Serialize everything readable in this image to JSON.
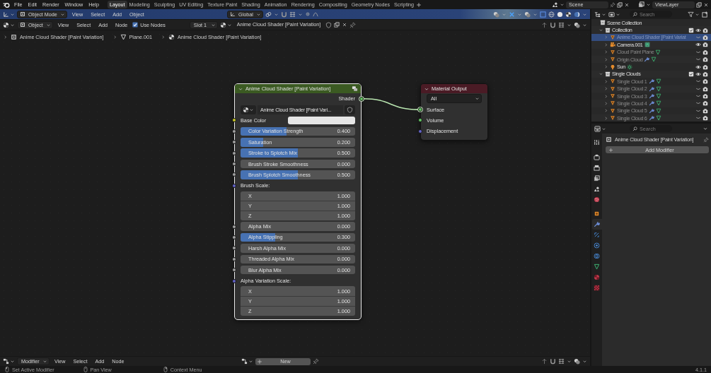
{
  "menu": [
    "File",
    "Edit",
    "Render",
    "Window",
    "Help"
  ],
  "workspaces": [
    {
      "label": "Layout",
      "selected": true
    },
    {
      "label": "Modeling",
      "selected": false
    },
    {
      "label": "Sculpting",
      "selected": false
    },
    {
      "label": "UV Editing",
      "selected": false
    },
    {
      "label": "Texture Paint",
      "selected": false
    },
    {
      "label": "Shading",
      "selected": false
    },
    {
      "label": "Animation",
      "selected": false
    },
    {
      "label": "Rendering",
      "selected": false
    },
    {
      "label": "Compositing",
      "selected": false
    },
    {
      "label": "Geometry Nodes",
      "selected": false
    },
    {
      "label": "Scripting",
      "selected": false
    }
  ],
  "scene": "Scene",
  "view_layer": "ViewLayer",
  "viewport_header": {
    "mode": "Object Mode",
    "menus": [
      "View",
      "Select",
      "Add",
      "Object"
    ],
    "orientation": "Global"
  },
  "node_editor": {
    "header": {
      "type": "Object",
      "menus": [
        "View",
        "Select",
        "Add",
        "Node"
      ],
      "use_nodes": {
        "label": "Use Nodes",
        "checked": true
      },
      "slot": "Slot 1",
      "material": "Anime Cloud Shader [Paint Variation]"
    },
    "breadcrumbs": [
      "Anime Cloud Shader [Paint Variation]",
      "Plane.001",
      "Anime Cloud Shader [Paint Variation]"
    ],
    "nodes": [
      {
        "kind": "group",
        "title": "Anime Cloud Shader [Paint Variation]",
        "selected": true,
        "outputs": [
          {
            "label": "Shader",
            "kind": "shader",
            "linked": true
          }
        ],
        "group": "Anime Cloud Shader [Paint Vari...",
        "inputs": [
          {
            "kind": "color",
            "label": "Base Color",
            "color": "#e6e6e6"
          },
          {
            "kind": "slider",
            "label": "Color Variation Strength",
            "value": "0.400",
            "level": 0.4
          },
          {
            "kind": "slider",
            "label": "Saturation",
            "value": "0.200",
            "level": 0.2
          },
          {
            "kind": "slider",
            "label": "Stroke to Splotch Mix",
            "value": "0.500",
            "level": 0.5
          },
          {
            "kind": "slider",
            "label": "Brush Stroke Smoothness",
            "value": "0.000",
            "level": 0
          },
          {
            "kind": "slider",
            "label": "Brush Splotch Smoothness",
            "value": "0.500",
            "level": 0.5
          },
          {
            "kind": "vector",
            "label": "Brush Scale:",
            "components": [
              {
                "label": "X",
                "value": "1.000"
              },
              {
                "label": "Y",
                "value": "1.000"
              },
              {
                "label": "Z",
                "value": "1.000"
              }
            ]
          },
          {
            "kind": "slider",
            "label": "Alpha Mix",
            "value": "0.000",
            "level": 0
          },
          {
            "kind": "slider",
            "label": "Alpha Stippling",
            "value": "0.300",
            "level": 0.3
          },
          {
            "kind": "slider",
            "label": "Harsh Alpha Mix",
            "value": "0.000",
            "level": 0
          },
          {
            "kind": "slider",
            "label": "Threaded Alpha Mix",
            "value": "0.000",
            "level": 0
          },
          {
            "kind": "slider",
            "label": "Blur Alpha Mix",
            "value": "0.000",
            "level": 0
          },
          {
            "kind": "vector",
            "label": "Alpha Variation Scale:",
            "components": [
              {
                "label": "X",
                "value": "1.000"
              },
              {
                "label": "Y",
                "value": "1.000"
              },
              {
                "label": "Z",
                "value": "1.000"
              }
            ]
          }
        ]
      },
      {
        "kind": "output",
        "title": "Material Output",
        "selected": false,
        "target": "All",
        "inputs": [
          {
            "label": "Surface",
            "kind": "shader",
            "linked": true
          },
          {
            "label": "Volume",
            "kind": "shader",
            "linked": false
          },
          {
            "label": "Displacement",
            "kind": "vector",
            "linked": false
          }
        ]
      }
    ]
  },
  "outliner": {
    "search": {
      "placeholder": "Search"
    },
    "tree": [
      {
        "kind": "scene_collection",
        "label": "Scene Collection",
        "selected": false,
        "children": [
          {
            "kind": "collection",
            "label": "Collection",
            "expanded": true,
            "selected": false,
            "checked": true,
            "visible": true,
            "children": [
              {
                "kind": "mesh",
                "label": "Anime Cloud Shader [Paint Variat",
                "expanded": false,
                "selected": true,
                "visible": false,
                "modifier": false,
                "data": false
              },
              {
                "kind": "camera",
                "label": "Camera.001",
                "expanded": false,
                "selected": false,
                "visible": true,
                "modifier": false,
                "data": true
              },
              {
                "kind": "mesh",
                "label": "Cloud Paint Plane",
                "expanded": false,
                "selected": false,
                "visible": false,
                "modifier": false,
                "data": true
              },
              {
                "kind": "mesh",
                "label": "Origin Cloud",
                "expanded": false,
                "selected": false,
                "visible": false,
                "modifier": true,
                "data": true
              },
              {
                "kind": "light",
                "label": "Sun",
                "expanded": false,
                "selected": false,
                "visible": true,
                "modifier": false,
                "data": true
              }
            ]
          },
          {
            "kind": "collection",
            "label": "Single Clouds",
            "expanded": true,
            "selected": false,
            "checked": true,
            "visible": true,
            "children": [
              {
                "kind": "mesh",
                "label": "Single Cloud 1",
                "expanded": false,
                "selected": false,
                "visible": false,
                "modifier": true,
                "data": true
              },
              {
                "kind": "mesh",
                "label": "Single Cloud 2",
                "expanded": false,
                "selected": false,
                "visible": false,
                "modifier": true,
                "data": true
              },
              {
                "kind": "mesh",
                "label": "Single Cloud 3",
                "expanded": false,
                "selected": false,
                "visible": false,
                "modifier": true,
                "data": true
              },
              {
                "kind": "mesh",
                "label": "Single Cloud 4",
                "expanded": false,
                "selected": false,
                "visible": false,
                "modifier": true,
                "data": true
              },
              {
                "kind": "mesh",
                "label": "Single Cloud 5",
                "expanded": false,
                "selected": false,
                "visible": false,
                "modifier": true,
                "data": true
              },
              {
                "kind": "mesh",
                "label": "Single Cloud 6",
                "expanded": false,
                "selected": false,
                "visible": false,
                "modifier": true,
                "data": true
              }
            ]
          }
        ]
      }
    ]
  },
  "properties": {
    "search": {
      "placeholder": "Search"
    },
    "tabs": [
      {
        "kind": "tool",
        "selected": false
      },
      {
        "kind": "render",
        "selected": false
      },
      {
        "kind": "output",
        "selected": false
      },
      {
        "kind": "view_layer",
        "selected": false
      },
      {
        "kind": "scene",
        "selected": false
      },
      {
        "kind": "world",
        "selected": false
      },
      {
        "kind": "object",
        "selected": false
      },
      {
        "kind": "modifiers",
        "selected": true
      },
      {
        "kind": "particles",
        "selected": false
      },
      {
        "kind": "physics",
        "selected": false
      },
      {
        "kind": "constraints",
        "selected": false
      },
      {
        "kind": "data",
        "selected": false
      },
      {
        "kind": "material",
        "selected": false
      },
      {
        "kind": "texture",
        "selected": false
      }
    ],
    "object_name": "Anime Cloud Shader [Paint Variation]",
    "add_button": "Add Modifier"
  },
  "lower_editor": {
    "type": "Modifier",
    "menus": [
      "View",
      "Select",
      "Add",
      "Node"
    ],
    "new_button": "New"
  },
  "status_bar": {
    "hints": [
      "Set Active Modifier",
      "Pan View",
      "Context Menu"
    ],
    "version": "4.1.1"
  }
}
